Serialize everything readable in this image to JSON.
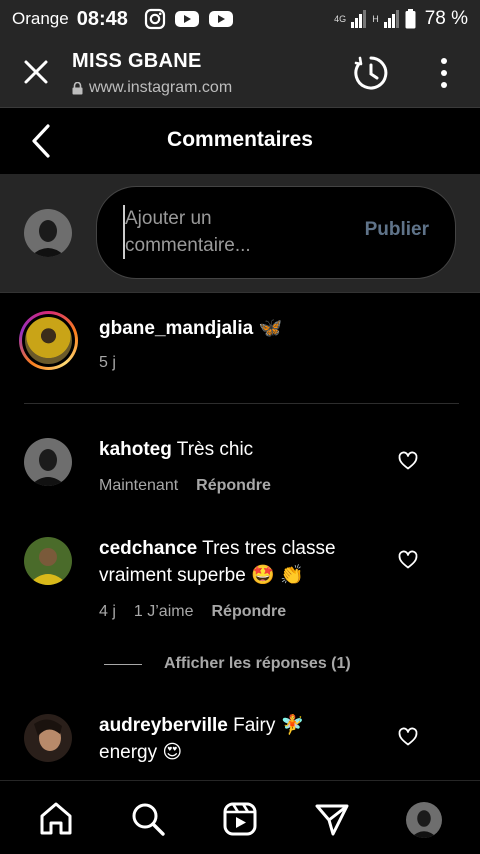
{
  "status": {
    "carrier": "Orange",
    "time": "08:48",
    "apps": [
      "instagram-icon",
      "youtube-icon",
      "youtube-icon"
    ],
    "network_1": "4G",
    "network_2": "H",
    "battery": "78 %"
  },
  "browser": {
    "title": "MISS GBANE",
    "url": "www.instagram.com"
  },
  "header": {
    "title": "Commentaires"
  },
  "composer": {
    "placeholder_line1": "Ajouter un",
    "placeholder_line2": "commentaire...",
    "publish_label": "Publier"
  },
  "caption": {
    "username": "gbane_mandjalia",
    "text": "🦋",
    "time": "5 j"
  },
  "comments": [
    {
      "username": "kahoteg",
      "text_line1": "Très chic",
      "text_line2": "",
      "time": "Maintenant",
      "likes": "",
      "reply_label": "Répondre"
    },
    {
      "username": "cedchance",
      "text_line1": "Tres tres classe",
      "text_line2": "vraiment superbe 🤩 👏",
      "time": "4 j",
      "likes": "1 J’aime",
      "reply_label": "Répondre"
    },
    {
      "username": "audreyberville",
      "text_line1": "Fairy 🧚",
      "text_line2": "energy 😍",
      "time": "",
      "likes": "",
      "reply_label": ""
    }
  ],
  "view_replies": "Afficher les réponses (1)",
  "nav": [
    "home-icon",
    "search-icon",
    "reels-icon",
    "direct-icon",
    "profile-avatar"
  ],
  "colors": {
    "accent_disabled": "#5f7389",
    "background": "#000000",
    "panel": "#262626"
  }
}
